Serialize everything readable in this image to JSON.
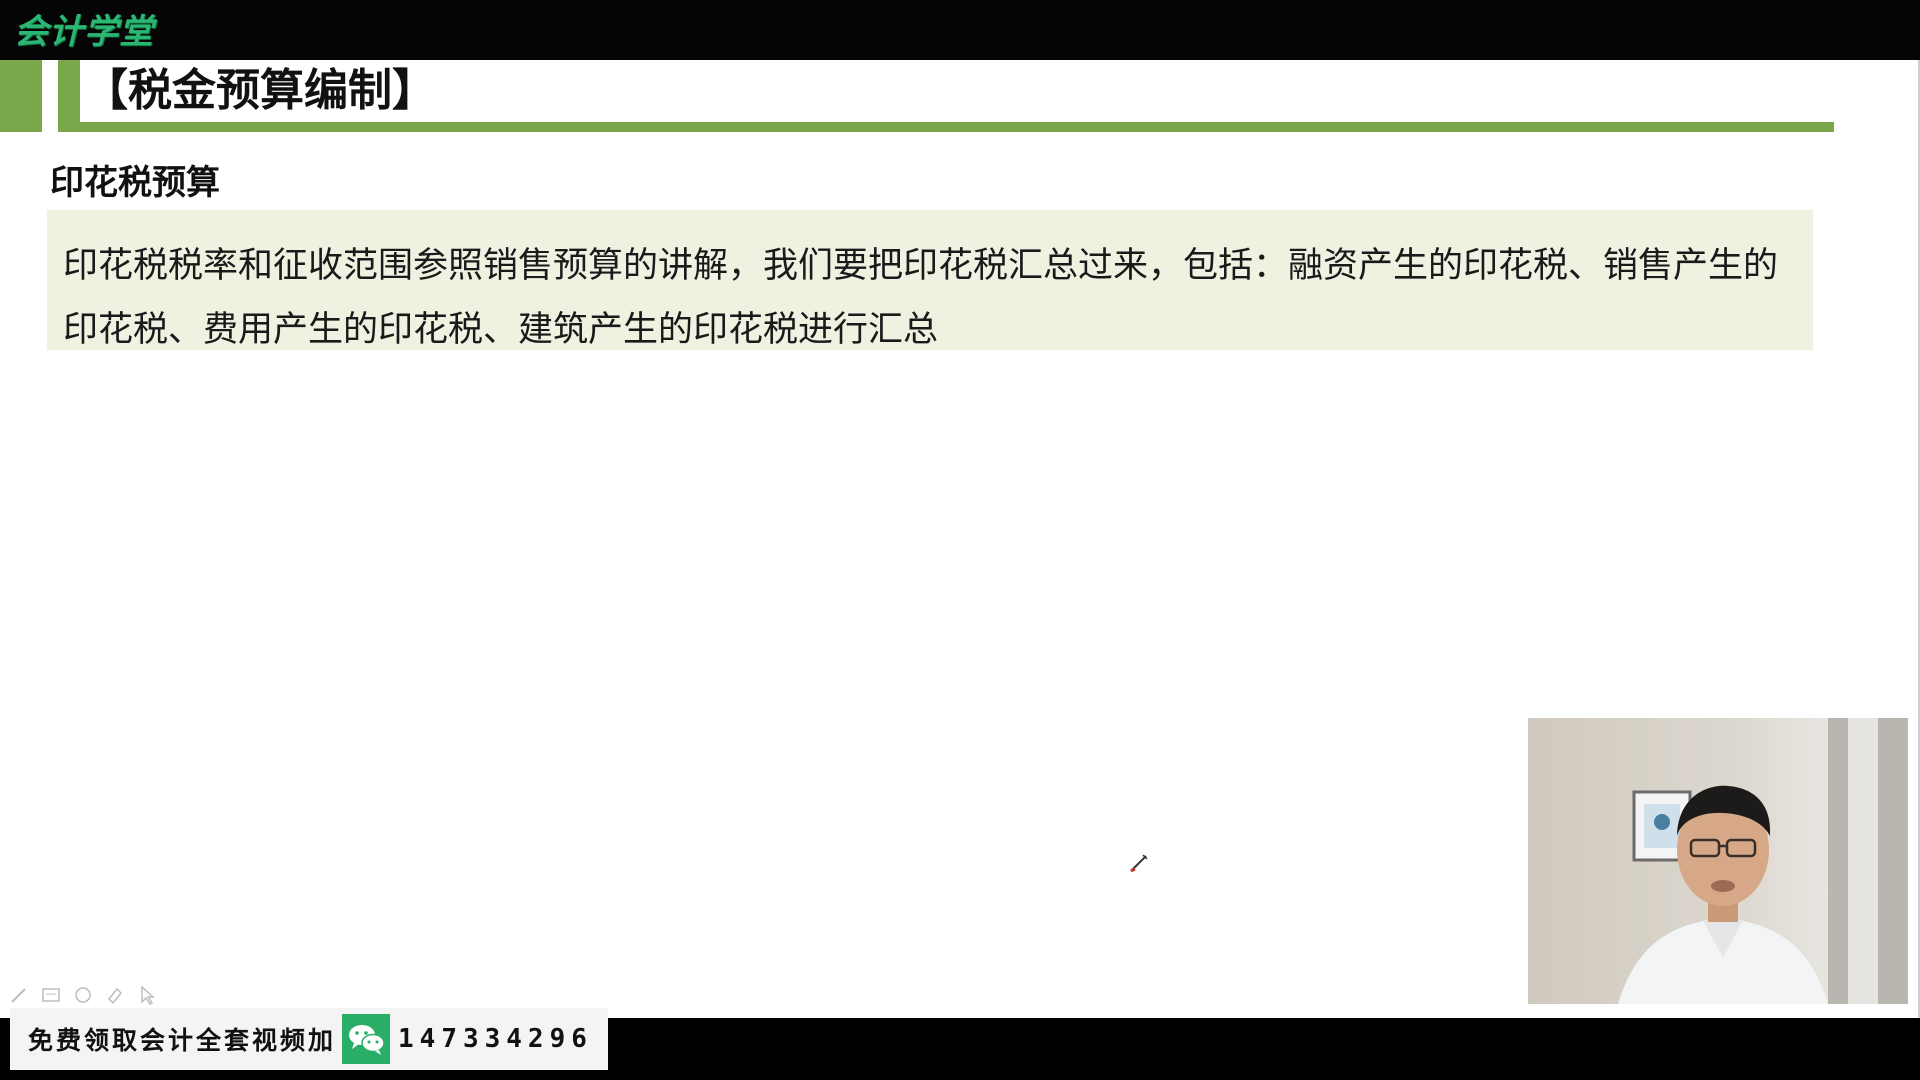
{
  "brand": {
    "logo_text": "会计学堂",
    "logo_color": "#2bb673"
  },
  "slide": {
    "title": "【税金预算编制】",
    "section_heading": "印花税预算",
    "body_text": "印花税税率和征收范围参照销售预算的讲解，我们要把印花税汇总过来，包括：融资产生的印花税、销售产生的印花税、费用产生的印花税、建筑产生的印花税进行汇总",
    "accent_color": "#7aa74a",
    "box_color": "#eef2e1"
  },
  "annotation_tools": [
    {
      "icon": "pen-icon"
    },
    {
      "icon": "whiteboard-icon"
    },
    {
      "icon": "eraser-icon"
    },
    {
      "icon": "highlighter-icon"
    },
    {
      "icon": "pointer-icon"
    }
  ],
  "promo": {
    "text": "免费领取会计全套视频加",
    "icon": "wechat-icon",
    "number": "147334296",
    "icon_color": "#2aae67"
  }
}
